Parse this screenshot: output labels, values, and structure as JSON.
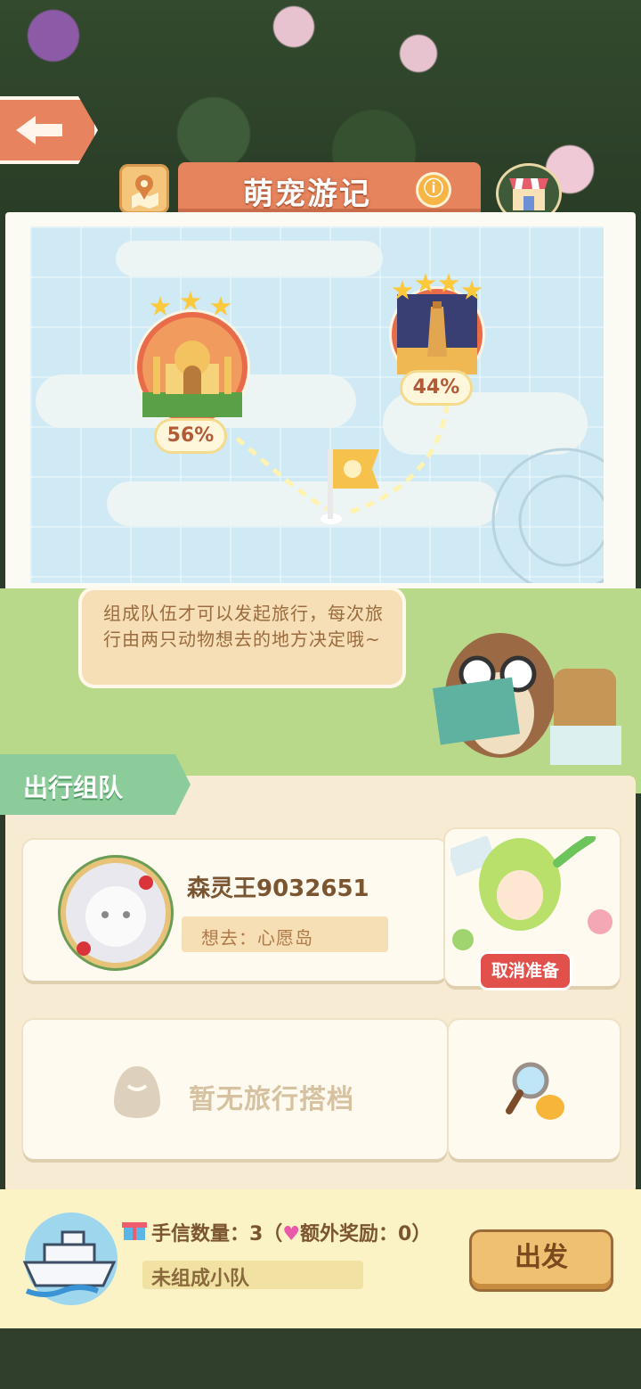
{
  "header": {
    "title": "萌宠游记",
    "info_icon": "ⓘ",
    "back_icon": "back-arrow-icon",
    "map_icon": "map-pin-icon",
    "shop_icon": "shop-icon"
  },
  "map": {
    "destinations": [
      {
        "name": "taj-mahal",
        "progress_label": "56%",
        "stars": 3
      },
      {
        "name": "lighthouse-tower",
        "progress_label": "44%",
        "stars": 4
      }
    ],
    "start_icon": "flag-icon"
  },
  "guide": {
    "text": "组成队伍才可以发起旅行，每次旅行由两只动物想去的地方决定哦~"
  },
  "team": {
    "section_label": "出行组队",
    "members": [
      {
        "name": "森灵王9032651",
        "want_label": "想去：心愿岛",
        "action_label": "取消准备"
      }
    ],
    "empty_label": "暂无旅行搭档"
  },
  "footer": {
    "letters_label": "手信数量：3（",
    "bonus_label": "额外奖励：0）",
    "status_label": "未组成小队",
    "go_label": "出发"
  },
  "colors": {
    "title_bar": "#e6845e",
    "panel": "#f7ecd3",
    "accent_red": "#e2504c",
    "tab_green": "#8ccc9b"
  }
}
